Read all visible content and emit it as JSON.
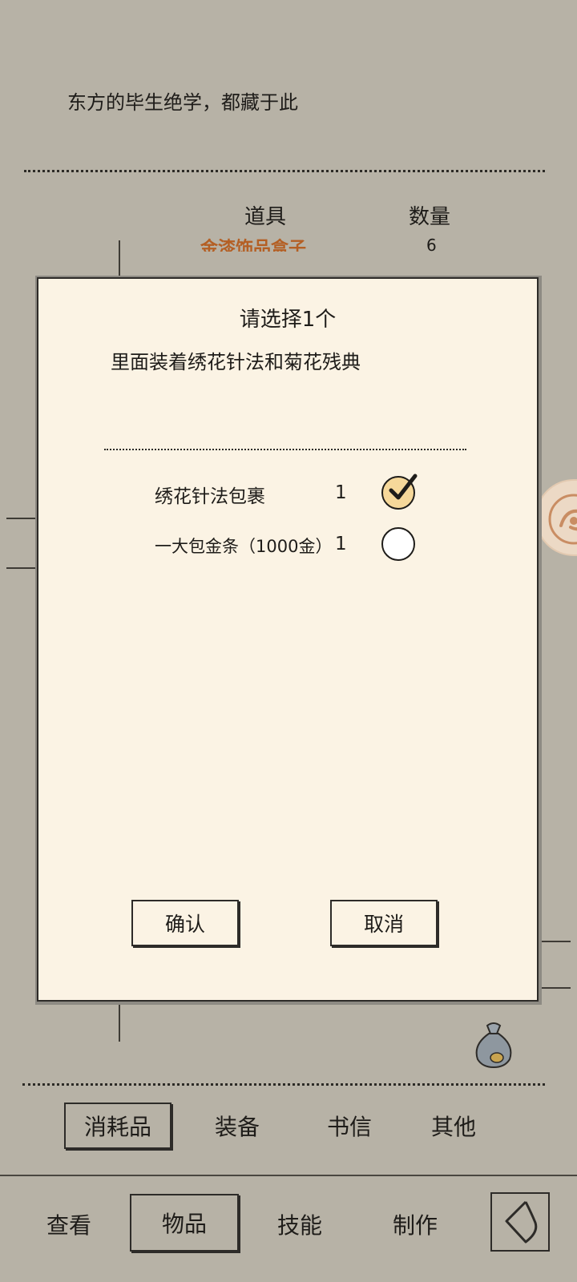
{
  "header": {
    "description": "东方的毕生绝学，都藏于此",
    "col_item": "道具",
    "col_qty": "数量",
    "bg_item_name": "金漆饰品盒子",
    "bg_item_qty": "6"
  },
  "modal": {
    "title": "请选择1个",
    "description": "里面装着绣花针法和菊花残典",
    "options": [
      {
        "label": "绣花针法包裹",
        "qty": "1",
        "selected": true
      },
      {
        "label": "一大包金条（1000金）",
        "qty": "1",
        "selected": false
      }
    ],
    "confirm_label": "确认",
    "cancel_label": "取消"
  },
  "category_tabs": [
    {
      "label": "消耗品",
      "active": true
    },
    {
      "label": "装备",
      "active": false
    },
    {
      "label": "书信",
      "active": false
    },
    {
      "label": "其他",
      "active": false
    }
  ],
  "nav_tabs": [
    {
      "label": "查看",
      "active": false
    },
    {
      "label": "物品",
      "active": true
    },
    {
      "label": "技能",
      "active": false
    },
    {
      "label": "制作",
      "active": false
    }
  ],
  "icons": {
    "back": "back-arrow-icon",
    "bag": "money-bag-icon",
    "float": "assistant-float-icon"
  },
  "colors": {
    "background": "#b7b2a6",
    "modal_bg": "#fbf3e4",
    "accent_orange": "#b45f24",
    "radio_selected": "#f6d89a"
  }
}
